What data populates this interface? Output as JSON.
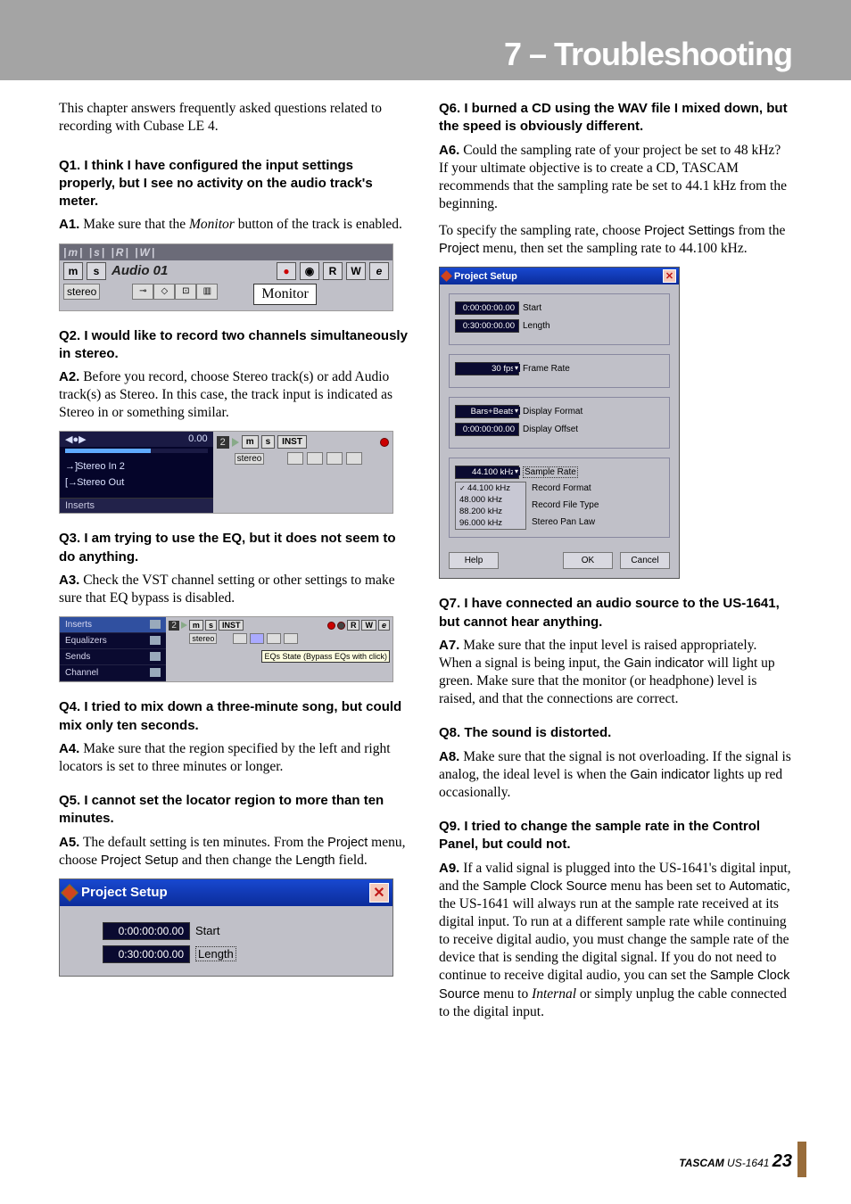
{
  "header": {
    "chapter_title": "7 – Troubleshooting"
  },
  "intro": "This chapter answers frequently asked questions related to recording with Cubase LE 4.",
  "q1": {
    "q": "Q1. I think I have configured the input settings properly, but I see no activity on the audio track's meter.",
    "a_label": "A1.",
    "a_pre": " Make sure that the ",
    "a_ital": "Monitor",
    "a_post": " button of the track is enabled."
  },
  "fig1": {
    "top_tab_labels": "|m| |s| |R| |W|",
    "m": "m",
    "s": "s",
    "track_name": "Audio 01",
    "R": "R",
    "W": "W",
    "e": "e",
    "stereo": "stereo",
    "monitor": "Monitor"
  },
  "q2": {
    "q": "Q2. I would like to record two channels simultaneously in stereo.",
    "a_label": "A2.",
    "a": " Before you record, choose Stereo track(s) or add Audio track(s) as Stereo. In this case, the track input is indicated as Stereo in or something similar."
  },
  "fig2": {
    "left_hdr_icon": "◀●▶",
    "left_hdr_val": "0.00",
    "row1": "Stereo In 2",
    "row2": "Stereo Out",
    "inserts": "Inserts",
    "num": "2",
    "m": "m",
    "s": "s",
    "inst": "INST",
    "stereo": "stereo"
  },
  "q3": {
    "q": "Q3. I am trying to use the EQ, but it does not seem to do anything.",
    "a_label": "A3.",
    "a": " Check the VST channel setting or other settings to make sure that EQ bypass is disabled."
  },
  "fig3": {
    "tabs": [
      "Inserts",
      "Equalizers",
      "Sends",
      "Channel"
    ],
    "num": "2",
    "m": "m",
    "s": "s",
    "inst": "INST",
    "R": "R",
    "W": "W",
    "e": "e",
    "stereo": "stereo",
    "tooltip": "EQs State (Bypass EQs with click)"
  },
  "q4": {
    "q": "Q4. I tried to mix down a three-minute song, but could mix only ten seconds.",
    "a_label": "A4.",
    "a": " Make sure that the region specified by the left and right locators is set to three minutes or longer."
  },
  "q5": {
    "q": "Q5. I cannot set the locator region to more than ten minutes.",
    "a_label": "A5.",
    "a_pre": " The default setting is ten minutes. From the ",
    "u1": "Project",
    "a_mid1": " menu, choose ",
    "u2": "Project Setup",
    "a_mid2": " and then change the ",
    "u3": "Length",
    "a_post": " field."
  },
  "fig4": {
    "title": "Project Setup",
    "start_val": "0:00:00:00.00",
    "start_lab": "Start",
    "length_val": "0:30:00:00.00",
    "length_lab": "Length"
  },
  "q6": {
    "q": "Q6. I burned a CD using the WAV file I mixed down, but the speed is obviously different.",
    "a_label": "A6.",
    "a": " Could the sampling rate of your project be set to 48 kHz? If your ultimate objective is to create a CD, TASCAM recommends that the sampling rate be set to 44.1 kHz from the beginning.",
    "p2_pre": "To specify the sampling rate, choose ",
    "p2_u1": "Project Settings",
    "p2_mid": " from the ",
    "p2_u2": "Project",
    "p2_post": " menu, then set the sampling rate to 44.100 kHz."
  },
  "fig5": {
    "title": "Project Setup",
    "g1": {
      "start_val": "0:00:00:00.00",
      "start_lab": "Start",
      "length_val": "0:30:00:00.00",
      "length_lab": "Length"
    },
    "g2": {
      "fr_val": "30 fps",
      "fr_lab": "Frame Rate"
    },
    "g3": {
      "df_val": "Bars+Beats",
      "df_lab": "Display Format",
      "do_val": "0:00:00:00.00",
      "do_lab": "Display Offset"
    },
    "g4": {
      "sr_val": "44.100 kHz",
      "sr_lab": "Sample Rate",
      "rf_lab": "Record Format",
      "rft_lab": "Record File Type",
      "spl_lab": "Stereo Pan Law"
    },
    "dd": [
      "44.100 kHz",
      "48.000 kHz",
      "88.200 kHz",
      "96.000 kHz"
    ],
    "btns": {
      "help": "Help",
      "ok": "OK",
      "cancel": "Cancel"
    }
  },
  "q7": {
    "q": "Q7. I have connected an audio source to the US-1641, but cannot hear anything.",
    "a_label": "A7.",
    "a_pre": " Make sure that the input level is raised appropriately. When a signal is being input, the ",
    "u1": "Gain indicator",
    "a_post": " will light up green. Make sure that the monitor (or headphone) level is raised, and that the connections are correct."
  },
  "q8": {
    "q": "Q8. The sound is distorted.",
    "a_label": "A8.",
    "a_pre": " Make sure that the signal is not overloading. If the signal is analog, the ideal level is when the ",
    "u1": "Gain indicator",
    "a_post": " lights up red occasionally."
  },
  "q9": {
    "q": "Q9. I tried to change the sample rate in the Control Panel, but could not.",
    "a_label": "A9.",
    "a_pre": " If a valid signal is plugged into the US-1641's digital input, and the ",
    "u1": "Sample Clock Source",
    "a_mid1": " menu has been set to ",
    "u2": "Automatic",
    "a_mid2": ", the US-1641 will always run at the sample rate received at its digital input. To run at a different sample rate while continuing to receive digital audio, you must change the sample rate of the device that is sending the digital signal. If you do not need to continue to receive digital audio, you can set the ",
    "u3": "Sample Clock Source",
    "a_mid3": " menu to ",
    "u4": "Internal",
    "a_post": " or simply unplug the cable connected to the digital input."
  },
  "footer": {
    "brand": "TASCAM",
    "model": " US-1641 ",
    "page": "23"
  }
}
